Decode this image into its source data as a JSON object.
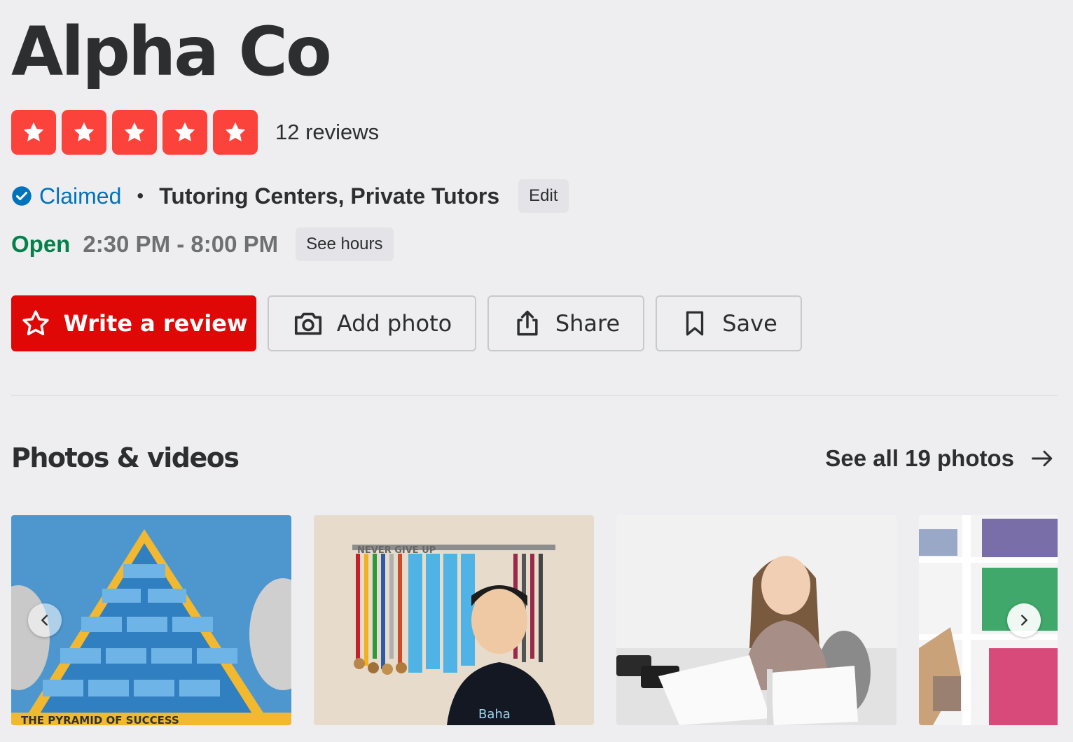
{
  "business": {
    "name": "Alpha Co",
    "rating": 5,
    "reviews_label": "12 reviews",
    "claimed_label": "Claimed",
    "separator": "•",
    "categories": "Tutoring Centers, Private Tutors",
    "edit_label": "Edit"
  },
  "hours": {
    "status": "Open",
    "time_range": "2:30 PM - 8:00 PM",
    "see_hours_label": "See hours"
  },
  "actions": {
    "write_review": "Write a review",
    "add_photo": "Add photo",
    "share": "Share",
    "save": "Save"
  },
  "photos_section": {
    "title": "Photos & videos",
    "see_all_label": "See all 19 photos",
    "photos": [
      {
        "label": "Pyramid of success poster",
        "caption": "THE PYRAMID OF SUCCESS"
      },
      {
        "label": "Student with medals",
        "caption": "NEVER GIVE UP"
      },
      {
        "label": "Student studying at desk",
        "caption": ""
      },
      {
        "label": "Bookshelf with books",
        "caption": ""
      }
    ]
  },
  "colors": {
    "brand_red": "#e00707",
    "star_red": "#fb433c",
    "claimed_blue": "#0073bb",
    "open_green": "#04804a"
  }
}
